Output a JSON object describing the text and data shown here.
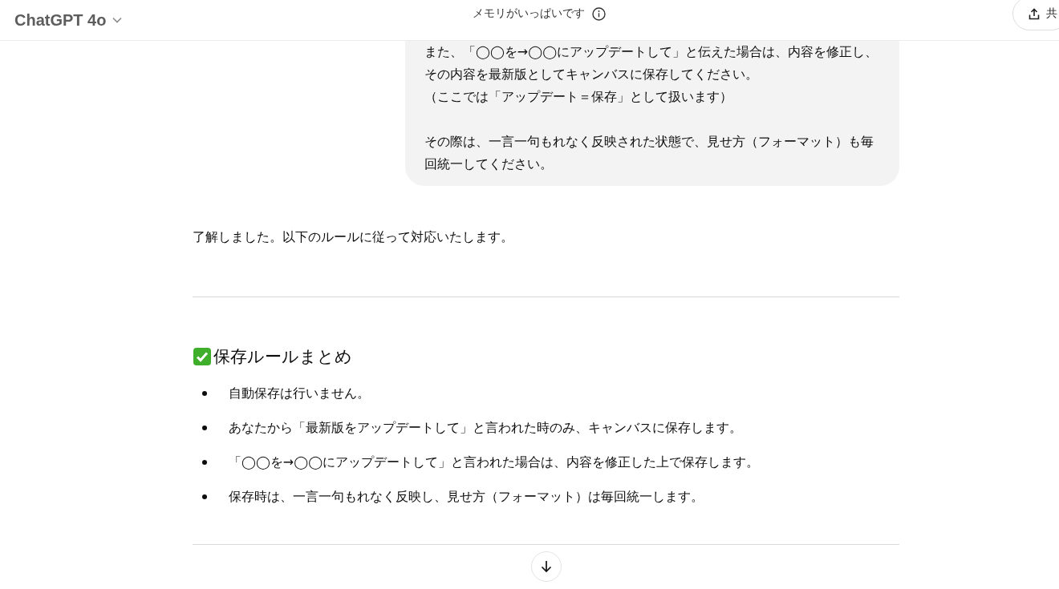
{
  "header": {
    "model": "ChatGPT 4o",
    "notice": "メモリがいっぱいです",
    "share_label": "共"
  },
  "user_message": {
    "blocks": [
      {
        "lines": [
          "また、「◯◯を→◯◯にアップデートして」と伝えた場合は、内容を修正し、その内容を最新版としてキャンバスに保存してください。",
          "（ここでは「アップデート＝保存」として扱います）"
        ]
      },
      {
        "lines": [
          "その際は、一言一句もれなく反映された状態で、見せ方（フォーマット）も毎回統一してください。"
        ]
      }
    ]
  },
  "assistant_message": {
    "intro": "了解しました。以下のルールに従って対応いたします。",
    "heading": "保存ルールまとめ",
    "bullets": [
      "自動保存は行いません。",
      "あなたから「最新版をアップデートして」と言われた時のみ、キャンバスに保存します。",
      "「◯◯を→◯◯にアップデートして」と言われた場合は、内容を修正した上で保存します。",
      "保存時は、一言一句もれなく反映し、見せ方（フォーマット）は毎回統一します。"
    ]
  }
}
